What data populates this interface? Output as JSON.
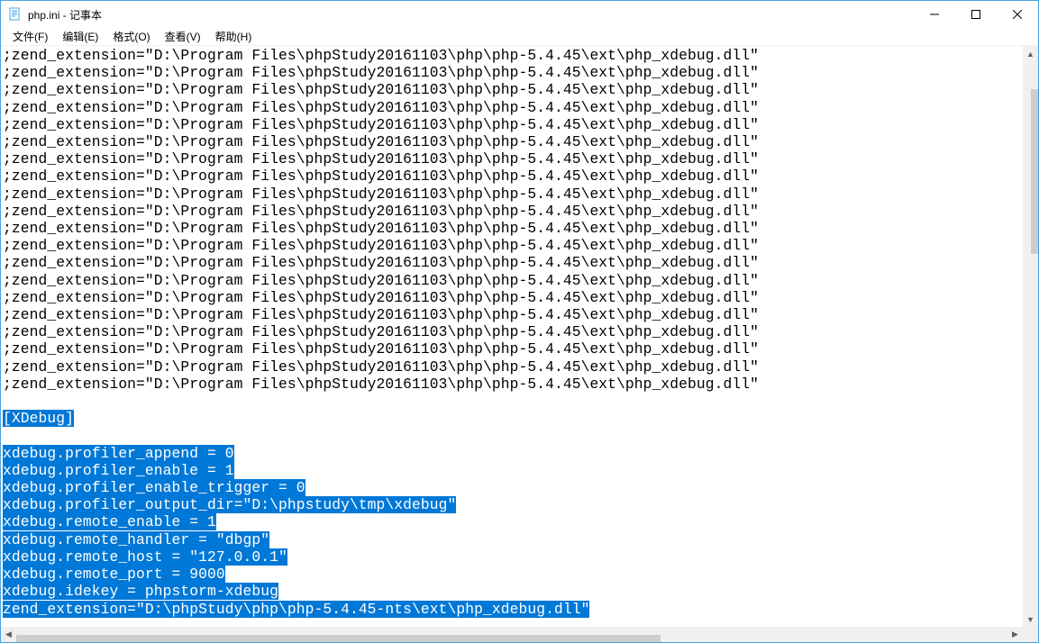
{
  "window": {
    "title": "php.ini - 记事本"
  },
  "menu": {
    "file": "文件(F)",
    "edit": "编辑(E)",
    "format": "格式(O)",
    "view": "查看(V)",
    "help": "帮助(H)"
  },
  "content": {
    "commented_line": ";zend_extension=\"D:\\Program Files\\phpStudy20161103\\php\\php-5.4.45\\ext\\php_xdebug.dll\"",
    "commented_repeat_count": 20,
    "blank1": "",
    "section_header": "[XDebug]",
    "blank2": "",
    "selected_lines": [
      "xdebug.profiler_append = 0",
      "xdebug.profiler_enable = 1",
      "xdebug.profiler_enable_trigger = 0",
      "xdebug.profiler_output_dir=\"D:\\phpstudy\\tmp\\xdebug\"",
      "xdebug.remote_enable = 1",
      "xdebug.remote_handler = \"dbgp\"",
      "xdebug.remote_host = \"127.0.0.1\"",
      "xdebug.remote_port = 9000",
      "xdebug.idekey = phpstorm-xdebug",
      "zend_extension=\"D:\\phpStudy\\php\\php-5.4.45-nts\\ext\\php_xdebug.dll\""
    ]
  }
}
